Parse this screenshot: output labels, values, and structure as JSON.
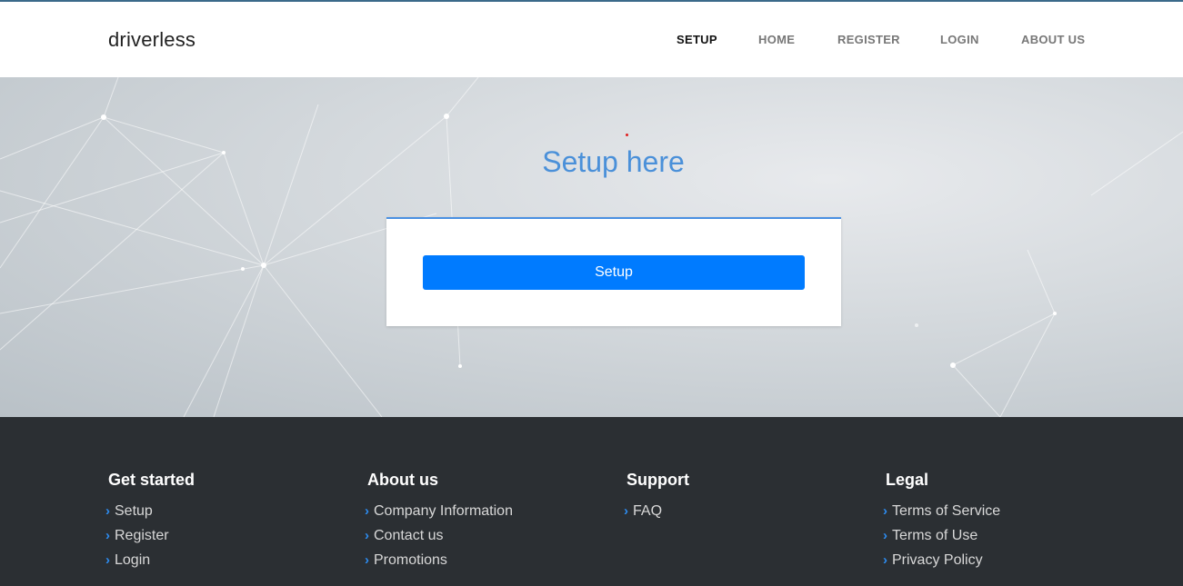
{
  "header": {
    "brand": "driverless",
    "nav": [
      {
        "label": "SETUP",
        "active": true
      },
      {
        "label": "HOME",
        "active": false
      },
      {
        "label": "REGISTER",
        "active": false
      },
      {
        "label": "LOGIN",
        "active": false
      },
      {
        "label": "ABOUT US",
        "active": false
      }
    ]
  },
  "hero": {
    "title": "Setup here",
    "button_label": "Setup"
  },
  "footer": {
    "columns": [
      {
        "heading": "Get started",
        "links": [
          "Setup",
          "Register",
          "Login"
        ]
      },
      {
        "heading": "About us",
        "links": [
          "Company Information",
          "Contact us",
          "Promotions"
        ]
      },
      {
        "heading": "Support",
        "links": [
          "FAQ"
        ]
      },
      {
        "heading": "Legal",
        "links": [
          "Terms of Service",
          "Terms of Use",
          "Privacy Policy"
        ]
      }
    ],
    "link_icon": "chevron-right-icon"
  },
  "colors": {
    "accent": "#4a90d9",
    "button": "#007bff",
    "footer_bg": "#2b2f33"
  }
}
